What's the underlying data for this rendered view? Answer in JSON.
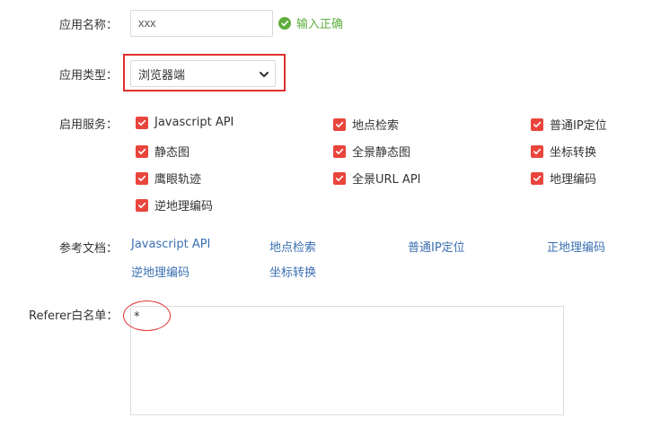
{
  "form": {
    "app_name_label": "应用名称：",
    "app_name_value": "xxx",
    "app_name_status": "输入正确",
    "app_type_label": "应用类型：",
    "app_type_value": "浏览器端",
    "services_label": "启用服务：",
    "services": [
      {
        "label": "Javascript API",
        "checked": true
      },
      {
        "label": "地点检索",
        "checked": true
      },
      {
        "label": "普通IP定位",
        "checked": true
      },
      {
        "label": "静态图",
        "checked": true
      },
      {
        "label": "全景静态图",
        "checked": true
      },
      {
        "label": "坐标转换",
        "checked": true
      },
      {
        "label": "鹰眼轨迹",
        "checked": true
      },
      {
        "label": "全景URL API",
        "checked": true
      },
      {
        "label": "地理编码",
        "checked": true
      },
      {
        "label": "逆地理编码",
        "checked": true
      }
    ],
    "docs_label": "参考文档：",
    "docs": [
      {
        "label": "Javascript API"
      },
      {
        "label": "地点检索"
      },
      {
        "label": "普通IP定位"
      },
      {
        "label": "正地理编码"
      },
      {
        "label": "逆地理编码"
      },
      {
        "label": "坐标转换"
      }
    ],
    "referer_label": "Referer白名单：",
    "referer_value": "*"
  },
  "colors": {
    "accent_checkbox": "#e8453c",
    "success": "#5fae3f",
    "link": "#3a6fb0",
    "highlight": "#e02f2f"
  }
}
